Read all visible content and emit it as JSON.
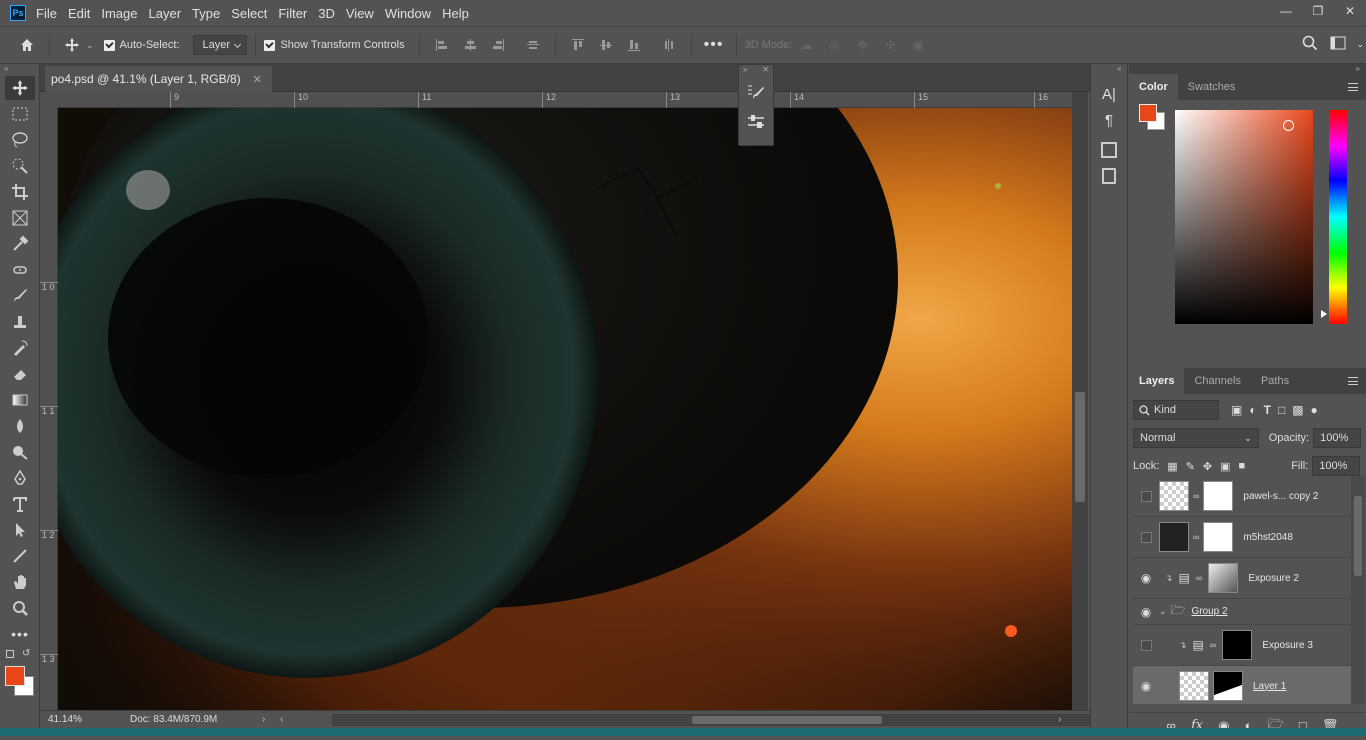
{
  "app": {
    "logo_text": "Ps"
  },
  "menu": [
    "File",
    "Edit",
    "Image",
    "Layer",
    "Type",
    "Select",
    "Filter",
    "3D",
    "View",
    "Window",
    "Help"
  ],
  "options": {
    "auto_select_label": "Auto-Select:",
    "auto_select_target": "Layer",
    "show_transform_label": "Show Transform Controls",
    "mode_3d_label": "3D Mode:"
  },
  "document": {
    "tab_title": "po4.psd @ 41.1% (Layer 1, RGB/8)",
    "zoom": "41.14%",
    "doc_info": "Doc: 83.4M/870.9M"
  },
  "ruler": {
    "h_ticks": [
      "9",
      "10",
      "11",
      "12",
      "13",
      "14",
      "15",
      "16"
    ],
    "v_ticks": [
      "1 0",
      "1 1",
      "1 2",
      "1 3"
    ]
  },
  "colors": {
    "foreground": "#e8471a",
    "background": "#ffffff",
    "accent": "#e8471a"
  },
  "color_panel": {
    "tabs": [
      "Color",
      "Swatches"
    ],
    "active": "Color"
  },
  "layers_panel": {
    "tabs": [
      "Layers",
      "Channels",
      "Paths"
    ],
    "filter_kind": "Kind",
    "blend_mode": "Normal",
    "opacity_label": "Opacity:",
    "opacity": "100%",
    "lock_label": "Lock:",
    "fill_label": "Fill:",
    "fill": "100%",
    "layers": [
      {
        "name": "pawel-s... copy 2",
        "visible": false
      },
      {
        "name": "m5hst2048",
        "visible": false
      },
      {
        "name": "Exposure 2",
        "visible": true
      },
      {
        "name": "Group 2",
        "visible": true
      },
      {
        "name": "Exposure 3",
        "visible": false
      },
      {
        "name": "Layer 1",
        "visible": true
      }
    ]
  }
}
